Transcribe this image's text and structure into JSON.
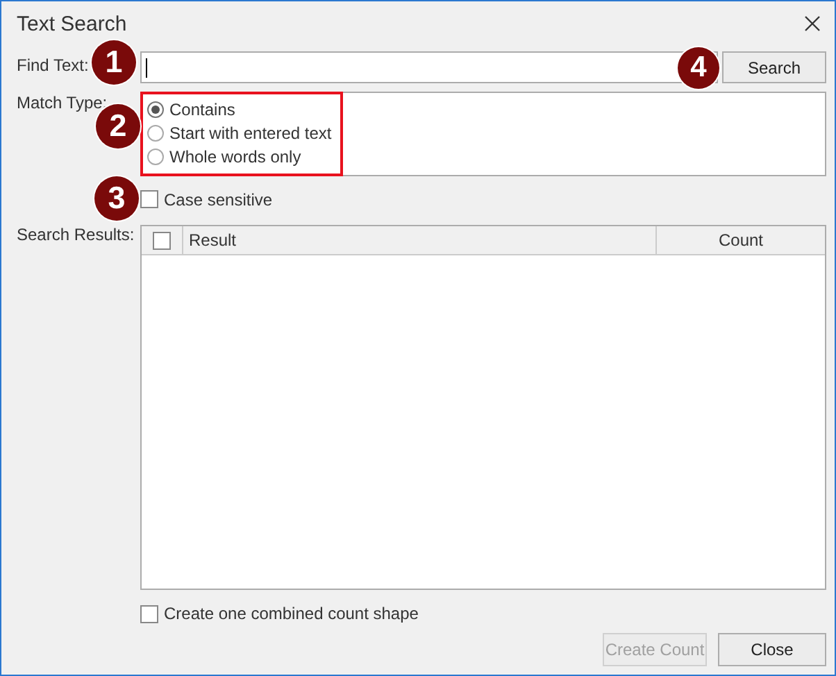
{
  "window": {
    "title": "Text Search"
  },
  "find_text": {
    "label": "Find Text:",
    "focused": true,
    "badge": "1"
  },
  "search_button": {
    "label": "Search",
    "badge": "4"
  },
  "match_type": {
    "label": "Match Type:",
    "highlighted": true,
    "badge": "2",
    "options": [
      {
        "label": "Contains",
        "selected": true
      },
      {
        "label": "Start with entered text",
        "selected": false
      },
      {
        "label": "Whole words only",
        "selected": false
      }
    ]
  },
  "case_sensitive": {
    "label": "Case sensitive",
    "checked": false,
    "badge": "3"
  },
  "results": {
    "label": "Search Results:",
    "select_all_checked": false,
    "columns": [
      "Result",
      "Count"
    ]
  },
  "combined_count": {
    "label": "Create one combined count shape",
    "checked": false
  },
  "buttons": [
    {
      "label": "Create Count",
      "disabled": true
    },
    {
      "label": "Close",
      "disabled": false
    }
  ]
}
